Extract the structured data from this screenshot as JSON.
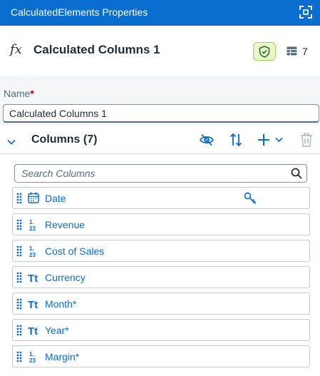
{
  "window": {
    "title": "CalculatedElements Properties",
    "expand_icon": "expand-icon"
  },
  "header": {
    "type_icon": "fx",
    "title": "Calculated Columns 1",
    "column_count": "7",
    "accent": "#0a6ed1",
    "shield_bg": "#ebf5cb"
  },
  "form": {
    "name_label": "Name",
    "required_marker": "*",
    "name_value": "Calculated Columns 1"
  },
  "columns_section": {
    "title": "Columns (7)",
    "search_placeholder": "Search Columns",
    "items": [
      {
        "name": "Date",
        "type": "date",
        "key": true
      },
      {
        "name": "Revenue",
        "type": "number",
        "key": false
      },
      {
        "name": "Cost of Sales",
        "type": "number",
        "key": false
      },
      {
        "name": "Currency",
        "type": "text",
        "key": false
      },
      {
        "name": "Month*",
        "type": "text",
        "key": false
      },
      {
        "name": "Year*",
        "type": "text",
        "key": false
      },
      {
        "name": "Margin*",
        "type": "number",
        "key": false
      }
    ]
  },
  "icons": {
    "text_type": "Tt",
    "number_top": "1.",
    "number_bottom": "23"
  }
}
